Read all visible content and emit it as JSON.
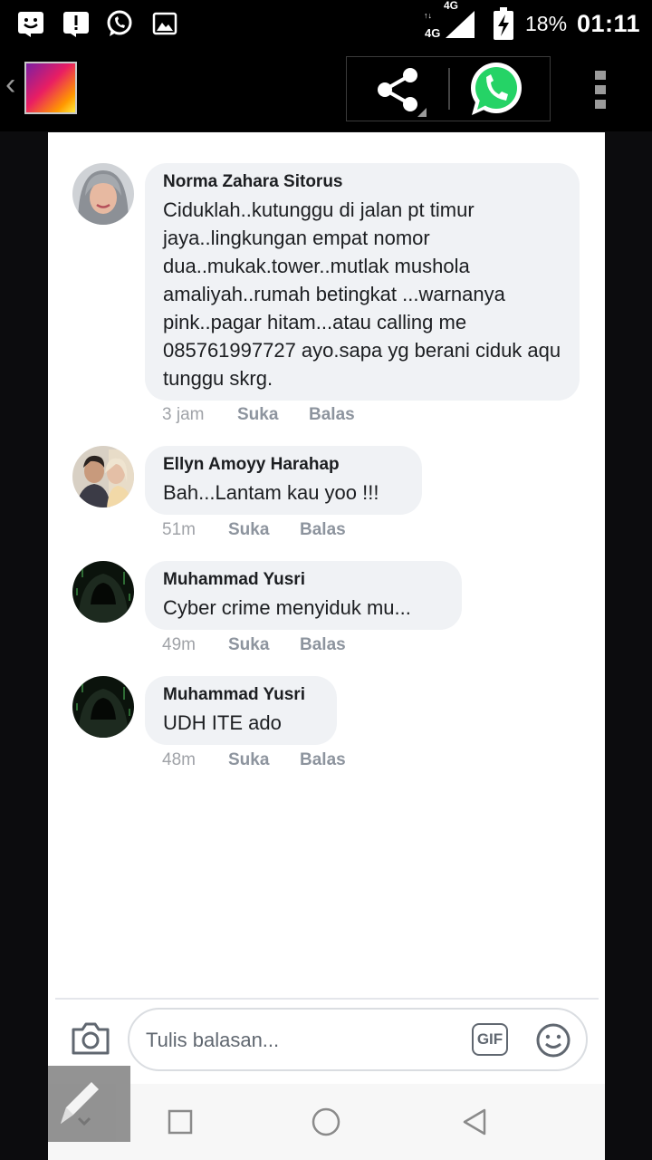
{
  "status_bar": {
    "icons_left": [
      "smiley-notification-icon",
      "alert-notification-icon",
      "whatsapp-notification-icon",
      "image-notification-icon"
    ],
    "network": "4G",
    "battery": "18%",
    "time": "01:11"
  },
  "toolbar": {
    "back": "‹",
    "share_icon": "share-icon",
    "whatsapp_icon": "whatsapp-icon",
    "overflow_icon": "more-vert-icon"
  },
  "comments": [
    {
      "author": "Norma Zahara Sitorus",
      "text": "Ciduklah..kutunggu di jalan pt timur jaya..lingkungan empat nomor dua..mukak.tower..mutlak mushola amaliyah..rumah betingkat ...warnanya pink..pagar hitam...atau calling me 085761997727 ayo.sapa yg berani ciduk aqu tunggu skrg.",
      "time": "3 jam",
      "like": "Suka",
      "reply": "Balas"
    },
    {
      "author": "Ellyn Amoyy Harahap",
      "text": "Bah...Lantam kau yoo !!!",
      "time": "51m",
      "like": "Suka",
      "reply": "Balas"
    },
    {
      "author": "Muhammad Yusri",
      "text": "Cyber crime menyiduk mu...",
      "time": "49m",
      "like": "Suka",
      "reply": "Balas"
    },
    {
      "author": "Muhammad Yusri",
      "text": "UDH ITE ado",
      "time": "48m",
      "like": "Suka",
      "reply": "Balas"
    }
  ],
  "reply_bar": {
    "placeholder": "Tulis balasan...",
    "gif_label": "GIF"
  },
  "colors": {
    "bubble": "#f0f2f5",
    "meta_text": "#90949c",
    "whatsapp_green": "#25d366"
  }
}
